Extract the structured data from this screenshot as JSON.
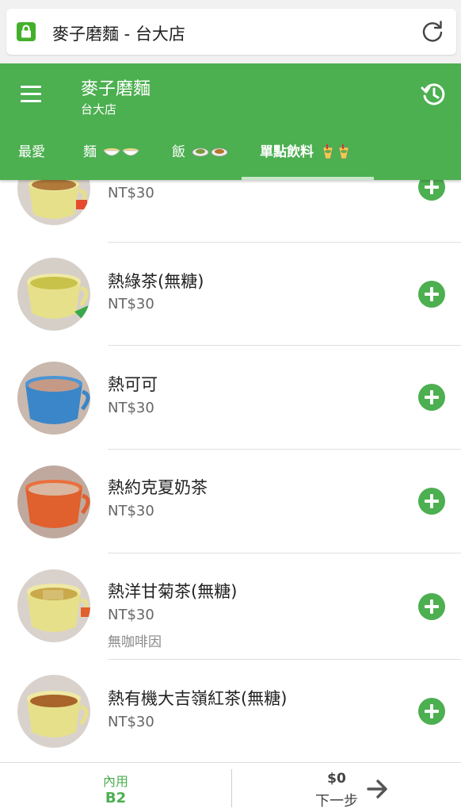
{
  "browser": {
    "url_text": "麥子磨麵 - 台大店"
  },
  "header": {
    "store_name": "麥子磨麵",
    "branch_name": "台大店"
  },
  "tabs": [
    {
      "label": "最愛",
      "active": false
    },
    {
      "label": "麵",
      "active": false
    },
    {
      "label": "飯",
      "active": false
    },
    {
      "label": "單點飲料",
      "active": true
    }
  ],
  "items": [
    {
      "name": "",
      "price": "NT$30",
      "note": "",
      "cup_color": "#e6e08a",
      "drink_color": "#b07a3a"
    },
    {
      "name": "熱綠茶(無糖)",
      "price": "NT$30",
      "note": "",
      "cup_color": "#e6e08a",
      "drink_color": "#c9c24a"
    },
    {
      "name": "熱可可",
      "price": "NT$30",
      "note": "",
      "cup_color": "#3a86c8",
      "drink_color": "#c49a86"
    },
    {
      "name": "熱約克夏奶茶",
      "price": "NT$30",
      "note": "",
      "cup_color": "#e0602e",
      "drink_color": "#d9b7a0"
    },
    {
      "name": "熱洋甘菊茶(無糖)",
      "price": "NT$30",
      "note": "無咖啡因",
      "cup_color": "#e6e08a",
      "drink_color": "#c9a94a"
    },
    {
      "name": "熱有機大吉嶺紅茶(無糖)",
      "price": "NT$30",
      "note": "",
      "cup_color": "#e6e08a",
      "drink_color": "#a8642a"
    }
  ],
  "bottom": {
    "order_type": "內用",
    "table": "B2",
    "total": "$0",
    "next_label": "下一步"
  },
  "colors": {
    "primary": "#4caf50",
    "tab_indicator": "#c8e6c9"
  },
  "icons": [
    "lock-icon",
    "reload-icon",
    "menu-icon",
    "history-icon",
    "noodle-bowl-icon",
    "rice-bowl-icon",
    "drink-icon",
    "add-icon",
    "arrow-right-icon"
  ]
}
